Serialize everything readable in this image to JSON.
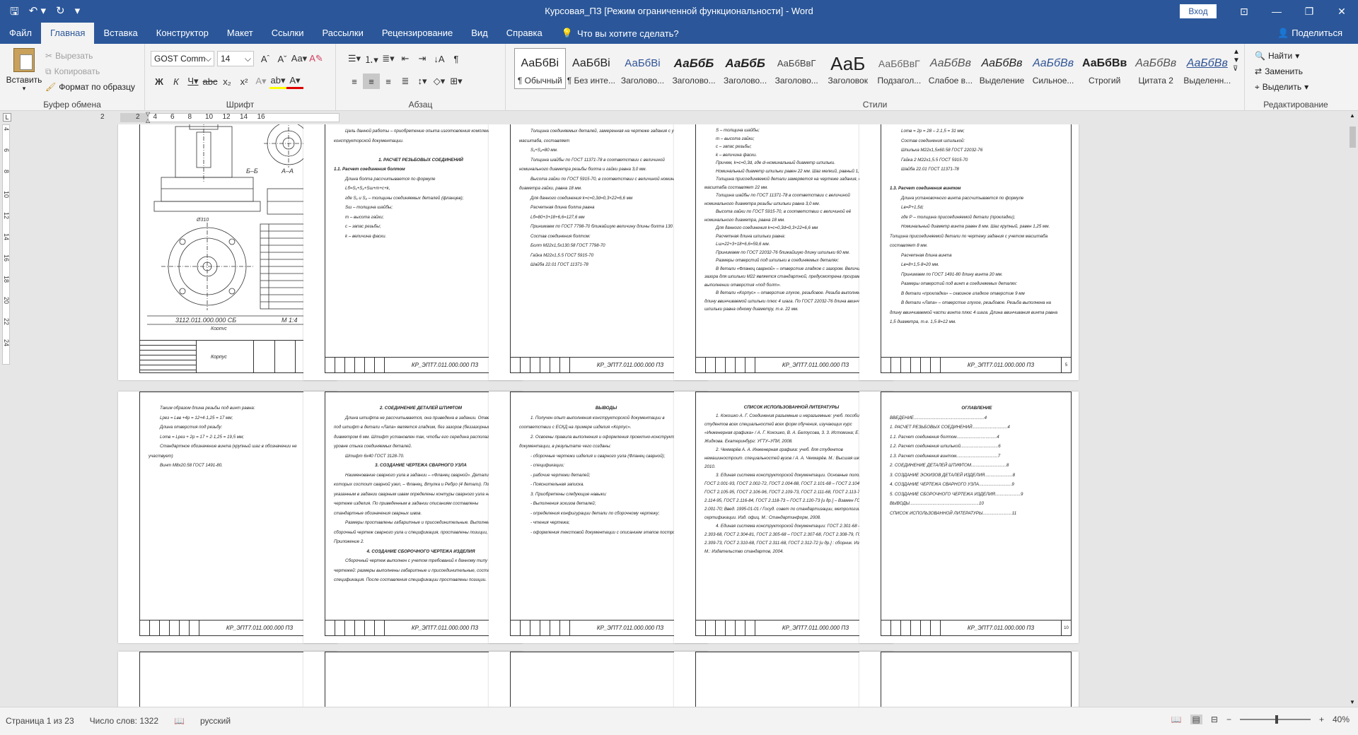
{
  "window": {
    "title": "Курсовая_ПЗ [Режим ограниченной функциональности]  -  Word",
    "signin": "Вход",
    "share": "Поделиться"
  },
  "qat": {
    "save_icon": "save-icon",
    "undo_icon": "undo-icon",
    "redo_icon": "redo-icon"
  },
  "tabs": [
    "Файл",
    "Главная",
    "Вставка",
    "Конструктор",
    "Макет",
    "Ссылки",
    "Рассылки",
    "Рецензирование",
    "Вид",
    "Справка"
  ],
  "tell": "Что вы хотите сделать?",
  "clipboard": {
    "paste": "Вставить",
    "cut": "Вырезать",
    "copy": "Копировать",
    "format": "Формат по образцу",
    "label": "Буфер обмена"
  },
  "font": {
    "name": "GOST Comm",
    "size": "14",
    "label": "Шрифт"
  },
  "paragraph": {
    "label": "Абзац"
  },
  "styles": {
    "label": "Стили",
    "items": [
      {
        "pv": "АаБбВі",
        "nm": "¶ Обычный"
      },
      {
        "pv": "АаБбВі",
        "nm": "¶ Без инте..."
      },
      {
        "pv": "АаБбВі",
        "nm": "Заголово..."
      },
      {
        "pv": "АаБбБ",
        "nm": "Заголово..."
      },
      {
        "pv": "АаБбБ",
        "nm": "Заголово..."
      },
      {
        "pv": "АаБбВвГ",
        "nm": "Заголово..."
      },
      {
        "pv": "АаБ",
        "nm": "Заголовок"
      },
      {
        "pv": "АаБбВвГ",
        "nm": "Подзагол..."
      },
      {
        "pv": "АаБбВв",
        "nm": "Слабое в..."
      },
      {
        "pv": "АаБбВв",
        "nm": "Выделение"
      },
      {
        "pv": "АаБбВв",
        "nm": "Сильное..."
      },
      {
        "pv": "АаБбВв",
        "nm": "Строгий"
      },
      {
        "pv": "АаБбВв",
        "nm": "Цитата 2"
      },
      {
        "pv": "АаБбВв",
        "nm": "Выделенн..."
      }
    ]
  },
  "editing": {
    "find": "Найти",
    "replace": "Заменить",
    "select": "Выделить",
    "label": "Редактирование"
  },
  "ruler": [
    "2",
    "2",
    "4",
    "6",
    "8",
    "10",
    "12",
    "14",
    "16"
  ],
  "vruler": [
    "4",
    "6",
    "8",
    "10",
    "12",
    "14",
    "16",
    "18",
    "20",
    "22",
    "24"
  ],
  "pages": {
    "code": "КР_ЭПТ7.011.000.000 ПЗ",
    "drawing": {
      "title": "3112.011.000.000 СБ",
      "scale": "М 1:4",
      "name": "Корпус",
      "sec1": "Б–Б",
      "sec2": "А–А",
      "dim": "Ø310"
    },
    "p2": {
      "intro": "Цель данной работы – приобретение опыта изготовления комплекта конструкторской документации.",
      "h1": "1. РАСЧЕТ РЕЗЬБОВЫХ СОЕДИНЕНИЙ",
      "h2": "1.1. Расчет соединения болтом",
      "t": [
        "Длина болта рассчитывается по формуле",
        "Lб=S₁+S₂+Sш+m+c+k,",
        "где S₁ и S₂ – толщины соединяемых деталей (фланцев);",
        "Sш – толщина шайбы;",
        "m – высота гайки;",
        "c – запас резьбы;",
        "k – величина фаски."
      ]
    },
    "p3": {
      "t": [
        "Толщина соединяемых деталей, замеренная на чертеже задания с учетом масштаба, составляет",
        "S₁+S₂=80 мм.",
        "Толщина шайбы по ГОСТ 11371-78 в соответствии с величиной номинального диаметра резьбы болта и гайки равна 3,0 мм.",
        "Высота гайки по ГОСТ 5915-70, в соответствии с величиной номинального диаметра гайки, равна 18 мм.",
        "Для данного соединения k=c=0,3d=0,3×22=6,6 мм",
        "Расчетная длина болта равна",
        "Lб=80+3+18+6,6=127,6 мм",
        "Принимаем по ГОСТ 7798-70 ближайшую величину длины болта 130 мм.",
        "Состав соединения болтом:",
        "Болт М22х1,5х130.58 ГОСТ 7798-70",
        "Гайка М22х1,5.5 ГОСТ 5915-70",
        "Шайба 22.01 ГОСТ 11371-78"
      ]
    },
    "p4": {
      "t": [
        "S – толщина шайбы;",
        "m – высота гайки;",
        "c – запас резьбы;",
        "k – величина фаски.",
        "Причем, k=c=0,3d, где d–номинальный диаметр шпильки.",
        "Номинальный диаметр шпильки равен 22 мм. Шаг мелкий, равный 1,5 мм.",
        "Толщина присоединяемой детали замеряется на чертеже задания, с учетом масштаба составляет 22 мм.",
        "Толщина шайбы по ГОСТ 11371-78 в соответствии с величиной номинального диаметра резьбы шпильки равна 3,0 мм.",
        "Высота гайки по ГОСТ 5915-70, в соответствии с величиной её номинального диаметра, равна 18 мм.",
        "Для данного соединения k=c=0,3d=0,3×22=6,6 мм",
        "Расчетная длина шпильки равна:",
        "Lш=22+3+18+6,6=59,6 мм.",
        "Принимаем по ГОСТ 22032-76 ближайшую длину шпильки 60 мм.",
        "Размеры отверстий под шпильки в соединяемых деталях:",
        "В детали «Фланец сварной» – отверстие гладкое с зазором. Величина зазора для шпильки М22 является стандартной, предусмотрена программой при выполнении отверстия «под болт».",
        "В детали «Корпус» – отверстие глухое, резьбовое. Резьба выполнена на длину ввинчиваемой шпильки плюс 4 шага. По ГОСТ 22032-76 длина ввинчиваемой шпильки равна одному диаметру, т.е. 22 мм."
      ]
    },
    "p5": {
      "t": [
        "Lотв = 2p = 28 – 2.1,5 = 31 мм;",
        "Состав соединения шпилькой:",
        "Шпилька М22х1,5х60.58 ГОСТ 22032-76",
        "Гайка 2 М22х1,5.5 ГОСТ 5915-70",
        "Шайба 22.01 ГОСТ 11371-78"
      ],
      "h": "1.3. Расчет соединения винтом",
      "t2": [
        "Длина установочного винта рассчитывается по формуле",
        "Lв=Р+1,5d;",
        "где Р – толщина присоединяемой детали (прокладки);",
        "Номинальный диаметр винта равен 8 мм. Шаг крупный, равен 1,25 мм. Толщина присоединяемой детали по чертежу задания с учетом масштаба составляет 8 мм.",
        "Расчетная длина винта",
        "Lв=8+1,5·8=20 мм.",
        "Принимаем по ГОСТ 1491-80 длину винта 20 мм.",
        "Размеры отверстий под винт в соединяемых деталях:",
        "В детали «прокладка» – сквозное гладкое отверстие 9 мм",
        "В детали «Лапа» – отверстие глухое, резьбовое. Резьба выполнена на длину ввинчиваемой части винта плюс 4 шага. Длина ввинчивания винта равна 1,5 диаметра, т.е. 1,5·8=12 мм."
      ]
    },
    "p6": {
      "t": [
        "Таким образом длина резьбы под винт равна:",
        "Lрез = Lвв +4p = 12+4·1,25 = 17 мм;",
        "Длина отверстия под резьбу:",
        "Lотв = Lрез + 2p = 17 + 2·1,25 = 19,5 мм;",
        "Стандартное обозначение винта (крупный шаг в обозначении не участвует)",
        "Винт М8х20.58 ГОСТ 1491-80."
      ]
    },
    "p7": {
      "h1": "2. СОЕДИНЕНИЕ ДЕТАЛЕЙ ШТИФТОМ",
      "t1": [
        "Длина штифта не рассчитывается, она приведена в задании. Отверстие под штифт в детали «Лапа» является гладким, без зазоров (беззазорным), диаметром 6 мм. Штифт установлен так, чтобы его середина располагалась на уровне стыка соединяемых деталей.",
        "Штифт 6х40 ГОСТ 3128-70."
      ],
      "h2": "3. СОЗДАНИЕ ЧЕРТЕЖА СВАРНОГО УЗЛА",
      "t2": [
        "Наименование сварного узла в задании – «Фланец сварной». Детали, из которых состоит сварной узел, – Фланец, Втулка и Ребро (4 детали). По указанным в задании сварным швам определены контуры сварного узла на чертеже изделия. По приведенным в задании описаниям составлены стандартные обозначения сварных швов.",
        "Размеры проставлены габаритные и присоединительные. Выполнен сборочный чертеж сварного узла и спецификация, проставлены позиции, см. Приложение 2."
      ],
      "h3": "4. СОЗДАНИЕ СБОРОЧНОГО ЧЕРТЕЖА ИЗДЕЛИЯ",
      "t3": [
        "Сборочный чертеж выполнен с учетом требований к данному типу чертежей: размеры выполнены габаритные и присоединительные, составлена спецификация. После составления спецификации проставлены позиции."
      ]
    },
    "p8": {
      "h": "ВЫВОДЫ",
      "t": [
        "1. Получен опыт выполнения конструкторской документации в соответствии с ЕСКД на примере изделия «Корпус».",
        "2. Освоены правила выполнения и оформления проектно-конструкторской документации, в результате чего созданы:",
        "- сборочные чертежи изделия и сварного узла (Фланец сварной);",
        "- спецификации;",
        "- рабочие чертежи деталей;",
        "- Пояснительная записка.",
        "3. Приобретены следующие навыки:",
        "- Выполнения эскизов деталей;",
        "- определения конфигурации детали по сборочному чертежу;",
        "- чтения чертежа;",
        "- оформления текстовой документации с описанием этапов построения."
      ]
    },
    "p9": {
      "h": "СПИСОК ИСПОЛЬЗОВАННОЙ ЛИТЕРАТУРЫ",
      "t": [
        "1. Кокошко А. Г. Соединения разъемные и неразъемные: учеб. пособие для студентов всех специальностей всех форм обучения, изучающих курс «Инженерная графика» / А. Г. Кокошко, В. А. Белоусова, 3. 3. Истомина; Е. Я. Жидкова. Екатеринбург: УГТУ–УПИ, 2008.",
        "2. Чекмарёв А. А. Инженерная графика: учеб. для студентов немашиностроит. специальностей вузов / А. А. Чекмарёв. М.: Высшая школа, 2010.",
        "3. Единая система конструкторской документации. Основные положения: ГОСТ 2.001-93, ГОСТ 2.002-72, ГОСТ 2.004-88, ГОСТ 2.101-68 – ГОСТ 2.104-2006, ГОСТ 2.105-95, ГОСТ 2.106-96, ГОСТ 2.109-73, ГОСТ 2.111-68, ГОСТ 2.113-75, ГОСТ 2.114-95, ГОСТ 2.116-84, ГОСТ 2.118-73 – ГОСТ 2.120-73 [и др.] – Взамен ГОСТ 2.001-70; Введ. 1995-01-01 / Госуд. совет по стандартизации, метрологии и сертификации. Изд. офиц. М.: Стандартинформ, 2008.",
        "4. Единая система конструкторской документации: ГОСТ 2.301-68 – ГОСТ 2.303-68, ГОСТ 2.304-81, ГОСТ 2.305-68 – ГОСТ 2.307-68, ГОСТ 2.308-79, ГОСТ 2.309-73, ГОСТ 2.310-68, ГОСТ 2.311-68, ГОСТ 2.312-72 [и др.] : сборник. Изд. офиц. М.: Издательство стандартов, 2004."
      ]
    },
    "p10": {
      "h": "ОГЛАВЛЕНИЕ",
      "t": [
        "ВВЕДЕНИЕ..........................................................4",
        "1. РАСЧЕТ РЕЗЬБОВЫХ СОЕДИНЕНИЙ.............................4",
        "1.1. Расчет соединения болтом.................................4",
        "1.2. Расчет соединения шпилькой...............................6",
        "1.3. Расчет соединения винтом..................................7",
        "2. СОЕДИНЕНИЕ ДЕТАЛЕЙ ШТИФТОМ.............................8",
        "3. СОЗДАНИЕ ЭСКИЗОВ ДЕТАЛЕЙ ИЗДЕЛИЯ.......................8",
        "4. СОЗДАНИЕ ЧЕРТЕЖА СВАРНОГО УЗЛА...........................9",
        "5. СОЗДАНИЕ СБОРОЧНОГО ЧЕРТЕЖА ИЗДЕЛИЯ.....................9",
        "ВЫВОДЫ.........................................................10",
        "СПИСОК ИСПОЛЬЗОВАННОЙ ЛИТЕРАТУРЫ........................11"
      ]
    },
    "nums": [
      "2",
      "3",
      "4",
      "5",
      "6",
      "7",
      "8",
      "9",
      "10",
      "11"
    ]
  },
  "status": {
    "page": "Страница 1 из 23",
    "words": "Число слов: 1322",
    "lang": "русский",
    "zoom": "40%",
    "zoom_fraction": 0.4
  }
}
